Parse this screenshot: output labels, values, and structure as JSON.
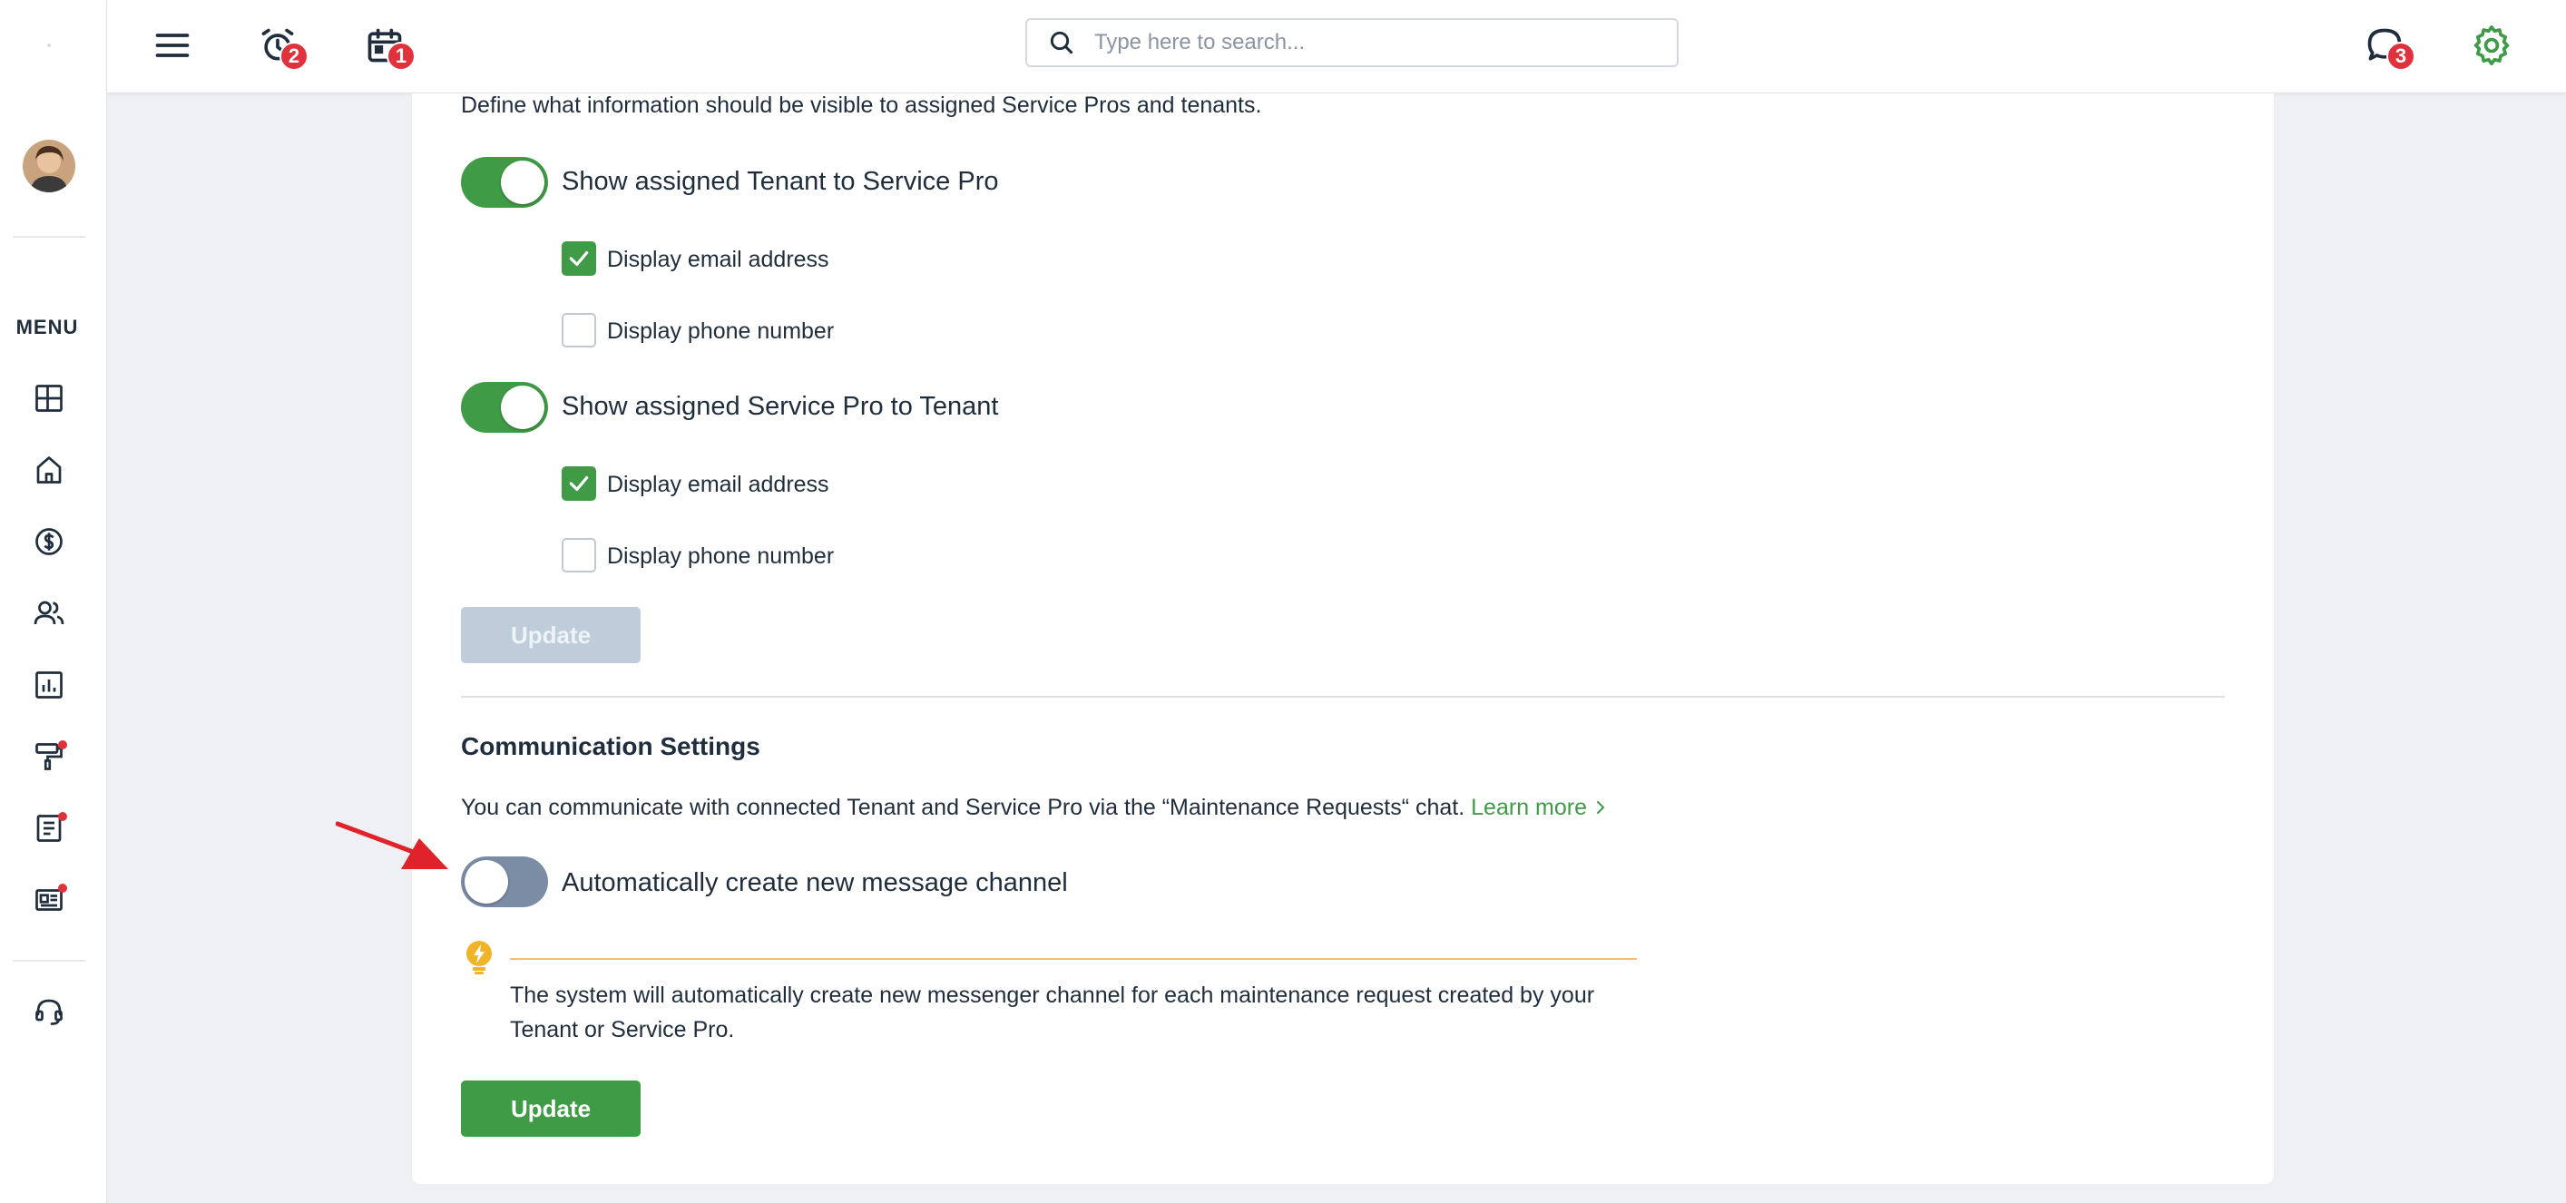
{
  "topbar": {
    "search_placeholder": "Type here to search...",
    "alarm_badge": "2",
    "calendar_badge": "1",
    "messages_badge": "3"
  },
  "sidebar": {
    "menu_label": "MENU",
    "icons": [
      "dashboard-icon",
      "home-icon",
      "dollar-icon",
      "users-icon",
      "chart-icon",
      "paint-roller-icon",
      "document-icon",
      "id-card-icon",
      "headset-icon"
    ]
  },
  "visibility": {
    "description": "Define what information should be visible to assigned Service Pros and tenants.",
    "toggle1_label": "Show assigned Tenant to Service Pro",
    "toggle1_email": "Display email address",
    "toggle1_phone": "Display phone number",
    "toggle2_label": "Show assigned Service Pro to Tenant",
    "toggle2_email": "Display email address",
    "toggle2_phone": "Display phone number",
    "update_label": "Update"
  },
  "communication": {
    "title": "Communication Settings",
    "description": "You can communicate with connected Tenant and Service Pro via the “Maintenance Requests“ chat.",
    "learn_more": "Learn more",
    "toggle_label": "Automatically create new message channel",
    "tip": "The system will automatically create new messenger channel for each maintenance request created by your Tenant or Service Pro.",
    "update_label": "Update"
  },
  "colors": {
    "accent_green": "#3f9b45",
    "badge_red": "#e0323c",
    "toggle_off": "#7b8da5",
    "tip_yellow": "#f0b429"
  }
}
